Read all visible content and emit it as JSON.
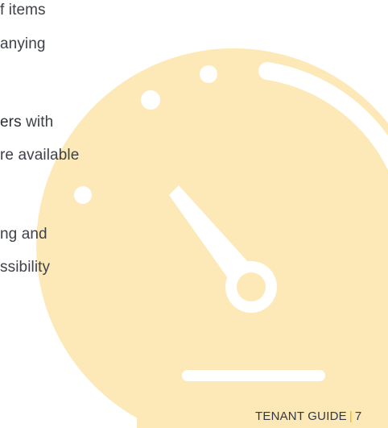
{
  "body_lines": [
    "f items",
    "anying",
    "",
    "with",
    "re available",
    "",
    "ng and",
    "ssibility"
  ],
  "highlight": "ers",
  "footer": {
    "label": "TENANT GUIDE",
    "separator": "|",
    "page": "7"
  },
  "colors": {
    "gauge_fill": "#fde9b8",
    "gauge_light": "#ffffff",
    "footer_accent": "#f5b400"
  },
  "icons": {
    "background": "speedometer-icon"
  }
}
